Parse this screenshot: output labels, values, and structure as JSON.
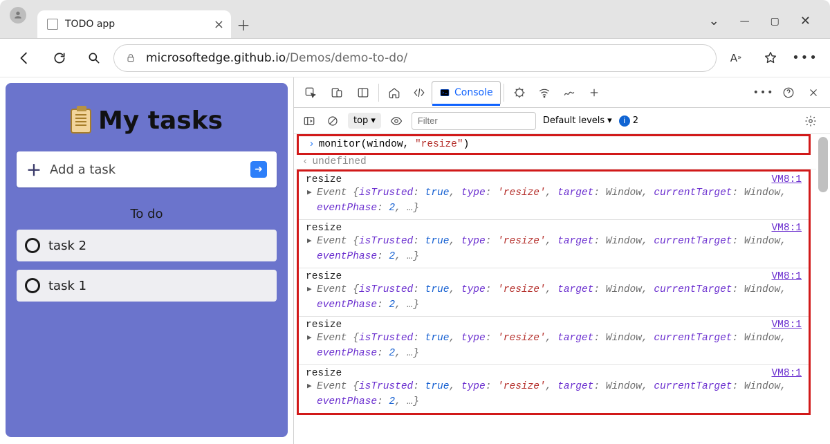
{
  "browser": {
    "tab_title": "TODO app",
    "url_host": "microsoftedge.github.io",
    "url_path": "/Demos/demo-to-do/"
  },
  "app": {
    "title": "My tasks",
    "add_placeholder": "Add a task",
    "section_label": "To do",
    "tasks": [
      "task 2",
      "task 1"
    ]
  },
  "devtools": {
    "active_tab": "Console",
    "context": "top",
    "filter_placeholder": "Filter",
    "levels_label": "Default levels",
    "issue_count": "2",
    "command": {
      "fn": "monitor",
      "arg1": "window",
      "arg2": "\"resize\""
    },
    "return_value": "undefined",
    "event_name": "resize",
    "log_source": "VM8:1",
    "event_detail": {
      "prefix": "Event {",
      "k1": "isTrusted",
      "v1": "true",
      "k2": "type",
      "v2": "'resize'",
      "k3": "target",
      "v3": "Window",
      "k4": "currentTarget",
      "v4": "Window",
      "k5": "eventPhase",
      "v5": "2",
      "suffix": ", …}"
    },
    "log_repeat": 5
  }
}
